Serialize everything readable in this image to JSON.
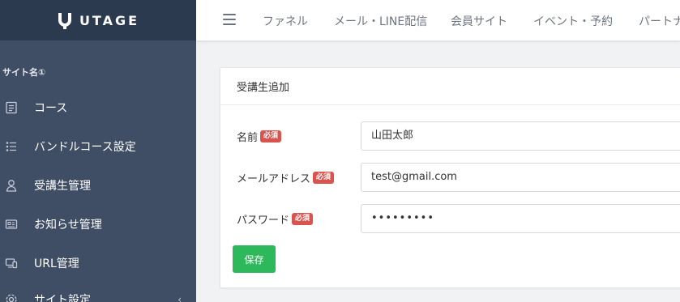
{
  "brand": {
    "logo_text": "UTAGE"
  },
  "sidebar": {
    "site_name": "サイト名①",
    "items": [
      {
        "label": "コース",
        "icon": "document-icon"
      },
      {
        "label": "バンドルコース設定",
        "icon": "list-icon"
      },
      {
        "label": "受講生管理",
        "icon": "user-icon"
      },
      {
        "label": "お知らせ管理",
        "icon": "newspaper-icon"
      },
      {
        "label": "URL管理",
        "icon": "devices-icon"
      },
      {
        "label": "サイト設定",
        "icon": "gear-icon",
        "chevron": "‹"
      }
    ]
  },
  "topnav": {
    "items": [
      "ファネル",
      "メール・LINE配信",
      "会員サイト",
      "イベント・予約",
      "パートナー"
    ]
  },
  "form": {
    "title": "受講生追加",
    "required_badge": "必須",
    "fields": [
      {
        "label": "名前",
        "value": "山田太郎"
      },
      {
        "label": "メールアドレス",
        "value": "test@gmail.com"
      },
      {
        "label": "パスワード",
        "value": "•••••••••"
      }
    ],
    "save_label": "保存"
  },
  "colors": {
    "sidebar_bg": "#3f4d65",
    "logo_bg": "#2c3a50",
    "required": "#d9534f",
    "save": "#2eb85c"
  }
}
